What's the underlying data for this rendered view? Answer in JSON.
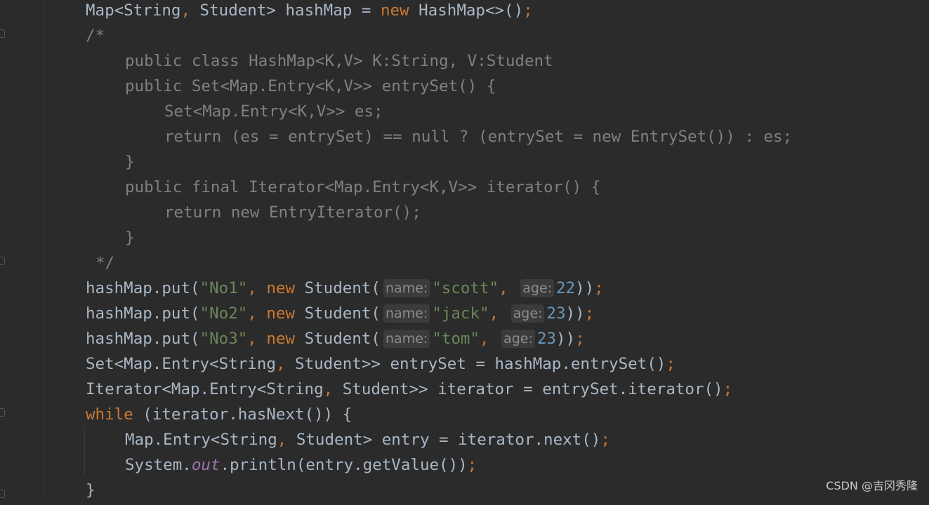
{
  "code": {
    "decl": {
      "type": "Map<String",
      "comma": ",",
      "type2": " Student> hashMap = ",
      "kw_new": "new",
      "rhs": " HashMap<>()",
      "semi": ";"
    },
    "comment_open": "/*",
    "c1": "public class HashMap<K,V> K:String, V:Student",
    "c2": "public Set<Map.Entry<K,V>> entrySet() {",
    "c3": "Set<Map.Entry<K,V>> es;",
    "c4": "return (es = entrySet) == null ? (entrySet = new EntrySet()) : es;",
    "c5": "}",
    "c6": "public final Iterator<Map.Entry<K,V>> iterator() {",
    "c7": "return new EntryIterator();",
    "c8": "}",
    "comment_close": "*/",
    "put_calls": [
      {
        "prefix": "hashMap.put(",
        "key": "\"No1\"",
        "name_hint": "name:",
        "name": "\"scott\"",
        "age_hint": "age:",
        "age": "22"
      },
      {
        "prefix": "hashMap.put(",
        "key": "\"No2\"",
        "name_hint": "name:",
        "name": "\"jack\"",
        "age_hint": "age:",
        "age": "23"
      },
      {
        "prefix": "hashMap.put(",
        "key": "\"No3\"",
        "name_hint": "name:",
        "name": "\"tom\"",
        "age_hint": "age:",
        "age": "23"
      }
    ],
    "comma": ",",
    "kw_new": "new",
    "student_ctor": " Student(",
    "close_paren": "))",
    "semi": ";",
    "entry_set_a": "Set<Map.Entry<String",
    "entry_set_b": " Student>> entrySet = hashMap.entrySet()",
    "iter_a": "Iterator<Map.Entry<String",
    "iter_b": " Student>> iterator = entrySet.iterator()",
    "kw_while": "while",
    "while_rest": " (iterator.hasNext()) {",
    "entry_a": "Map.Entry<String",
    "entry_b": " Student> entry = iterator.next()",
    "sys_a": "System.",
    "sys_field": "out",
    "sys_b": ".println(entry.getValue())",
    "close_brace": "}"
  },
  "watermark": "CSDN @吉冈秀隆"
}
